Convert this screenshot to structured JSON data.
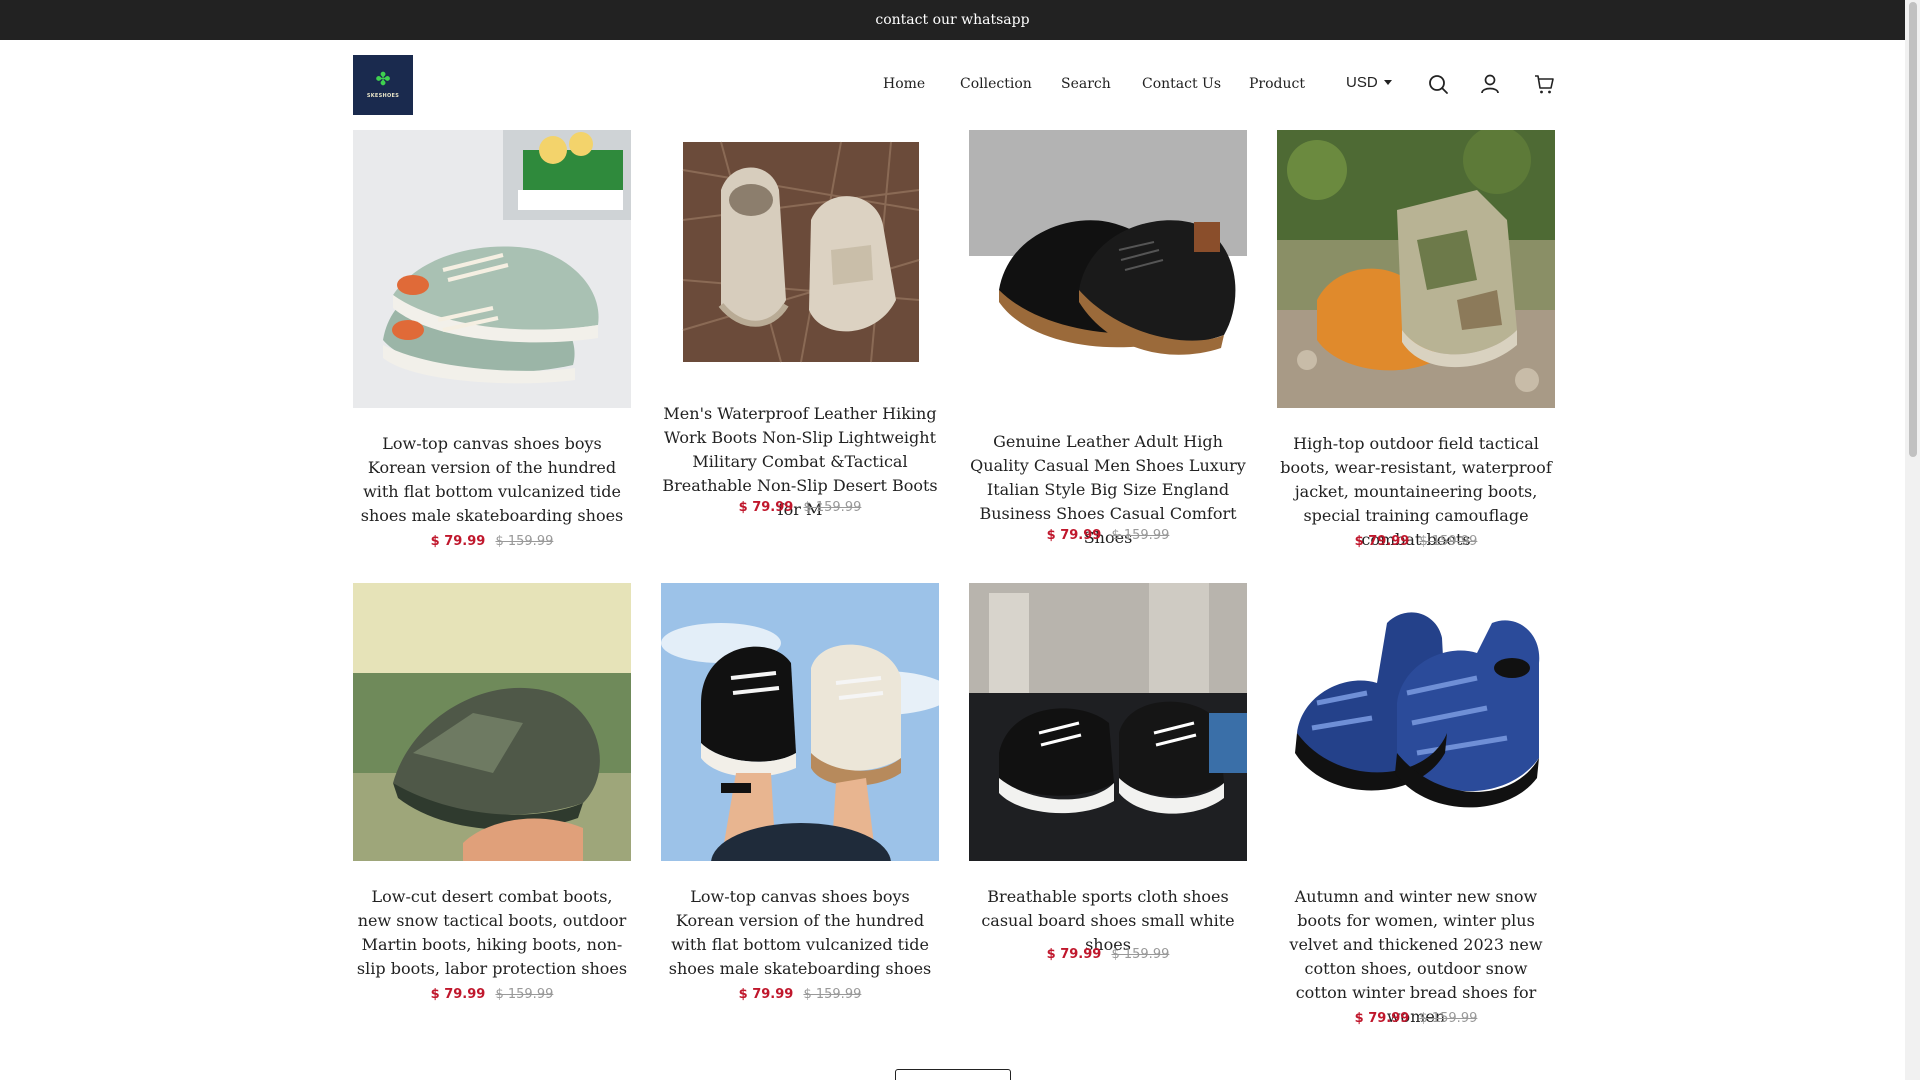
{
  "announcement": "contact our whatsapp",
  "logo": {
    "text": "SKESHOES",
    "icon": "clover-icon"
  },
  "nav": {
    "items": [
      "Home",
      "Collection",
      "Search",
      "Contact Us",
      "Product"
    ],
    "currency": "USD"
  },
  "icons": {
    "search": "search-icon",
    "account": "user-icon",
    "cart": "cart-icon"
  },
  "colors": {
    "topbar": "#222222",
    "price": "#c0172c",
    "old_price": "#999999"
  },
  "products": [
    {
      "title": "Low-top canvas shoes boys Korean version of the hundred with flat bottom vulcanized tide shoes male skateboarding shoes",
      "price": "$ 79.99",
      "compare_price": "$ 159.99",
      "image": "green-canvas-sneakers"
    },
    {
      "title": "Men's Waterproof Leather Hiking Work Boots Non-Slip Lightweight Military Combat &Tactical Breathable Non-Slip Desert Boots for M",
      "price": "$ 79.99",
      "compare_price": "$ 159.99",
      "image": "beige-desert-boots"
    },
    {
      "title": "Genuine Leather Adult High Quality Casual Men Shoes Luxury Italian Style Big Size England Business Shoes Casual Comfort Shoes",
      "price": "$ 79.99",
      "compare_price": "$ 159.99",
      "image": "black-leather-shoes"
    },
    {
      "title": "High-top outdoor field tactical boots, wear-resistant, waterproof jacket, mountaineering boots, special training camouflage combat boots",
      "price": "$ 79.99",
      "compare_price": "$ 159.99",
      "image": "camo-tactical-boots"
    },
    {
      "title": "Low-cut desert combat boots, new snow tactical boots, outdoor Martin boots, hiking boots, non-slip boots, labor protection shoes",
      "price": "$ 79.99",
      "compare_price": "$ 159.99",
      "image": "green-hiking-shoe"
    },
    {
      "title": "Low-top canvas shoes boys Korean version of the hundred with flat bottom vulcanized tide shoes male skateboarding shoes",
      "price": "$ 79.99",
      "compare_price": "$ 159.99",
      "image": "canvas-sneakers-sky"
    },
    {
      "title": "Breathable sports cloth shoes casual board shoes small white shoes",
      "price": "$ 79.99",
      "compare_price": "$ 159.99",
      "image": "black-cloth-sneakers"
    },
    {
      "title": "Autumn and winter new snow boots for women, winter plus velvet and thickened 2023 new cotton shoes, outdoor snow cotton winter bread shoes for women",
      "price": "$ 79.99",
      "compare_price": "$ 159.99",
      "image": "blue-snow-boots"
    }
  ]
}
